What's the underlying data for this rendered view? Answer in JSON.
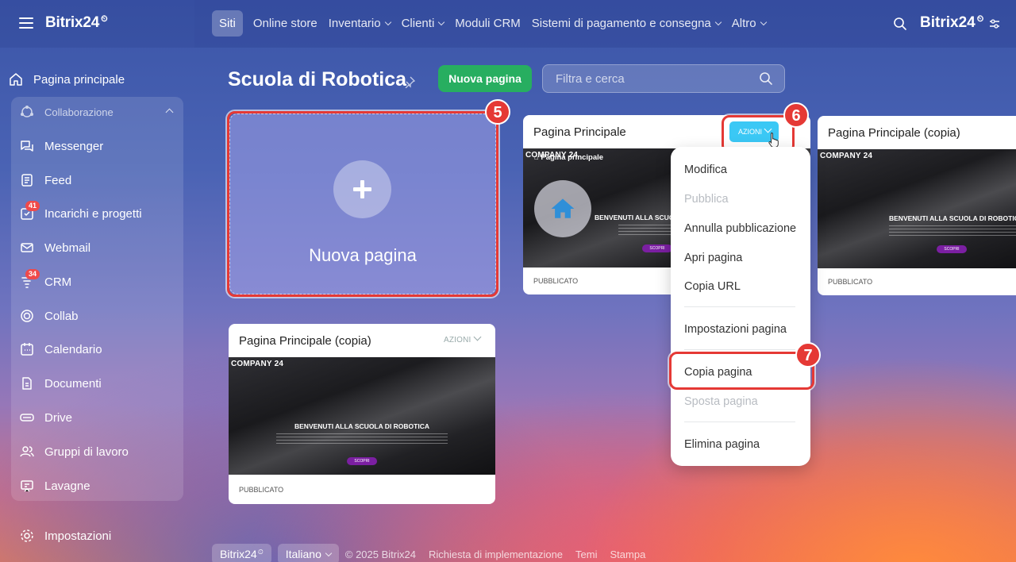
{
  "app": {
    "logo": "Bitrix24",
    "logo_mark": "⏲"
  },
  "topnav": {
    "items": [
      {
        "label": "Siti",
        "active": true,
        "dropdown": false
      },
      {
        "label": "Online store",
        "dropdown": false
      },
      {
        "label": "Inventario",
        "dropdown": true
      },
      {
        "label": "Clienti",
        "dropdown": true
      },
      {
        "label": "Moduli CRM",
        "dropdown": false
      },
      {
        "label": "Sistemi di pagamento e consegna",
        "dropdown": true
      },
      {
        "label": "Altro",
        "dropdown": true
      }
    ],
    "right_logo": "Bitrix24"
  },
  "sidebar": {
    "home": "Pagina principale",
    "group_header": "Collaborazione",
    "items": [
      {
        "label": "Messenger",
        "icon": "messenger-icon"
      },
      {
        "label": "Feed",
        "icon": "feed-icon"
      },
      {
        "label": "Incarichi e progetti",
        "icon": "tasks-icon",
        "badge": "41"
      },
      {
        "label": "Webmail",
        "icon": "mail-icon"
      },
      {
        "label": "CRM",
        "icon": "crm-icon",
        "badge": "34"
      },
      {
        "label": "Collab",
        "icon": "collab-icon"
      },
      {
        "label": "Calendario",
        "icon": "calendar-icon"
      },
      {
        "label": "Documenti",
        "icon": "document-icon"
      },
      {
        "label": "Drive",
        "icon": "drive-icon"
      },
      {
        "label": "Gruppi di lavoro",
        "icon": "groups-icon"
      },
      {
        "label": "Lavagne",
        "icon": "board-icon"
      }
    ],
    "settings": "Impostazioni"
  },
  "page": {
    "title": "Scuola di Robotica",
    "new_button": "Nuova pagina",
    "filter_placeholder": "Filtra e cerca"
  },
  "new_card": {
    "label": "Nuova pagina"
  },
  "cards": [
    {
      "title": "Pagina Principale",
      "actions": "AZIONI",
      "status": "PUBBLICATO",
      "preview_brand": "COMPANY 24",
      "preview_heading": "BENVENUTI ALLA SCUOLA DI ROBOTICA",
      "preview_button": "SCOPRI",
      "preview_page": "Pagina principale"
    },
    {
      "title": "Pagina Principale (copia)",
      "actions": "AZIONI",
      "status": "PUBBLICATO",
      "preview_brand": "COMPANY 24",
      "preview_heading": "BENVENUTI ALLA SCUOLA DI ROBOTICA",
      "preview_button": "SCOPRI"
    },
    {
      "title": "Pagina Principale (copia)",
      "actions": "AZIONI",
      "status": "PUBBLICATO",
      "preview_brand": "COMPANY 24",
      "preview_heading": "BENVENUTI ALLA SCUOLA DI ROBOTICA",
      "preview_button": "SCOPRI"
    }
  ],
  "menu": {
    "items": [
      {
        "label": "Modifica",
        "disabled": false
      },
      {
        "label": "Pubblica",
        "disabled": true
      },
      {
        "label": "Annulla pubblicazione",
        "disabled": false
      },
      {
        "label": "Apri pagina",
        "disabled": false
      },
      {
        "label": "Copia URL",
        "disabled": false
      },
      {
        "label": "Impostazioni pagina",
        "disabled": false
      },
      {
        "label": "Copia pagina",
        "disabled": false
      },
      {
        "label": "Sposta pagina",
        "disabled": true
      },
      {
        "label": "Elimina pagina",
        "disabled": false
      }
    ]
  },
  "callouts": [
    "5",
    "6",
    "7"
  ],
  "footer": {
    "brand": "Bitrix24",
    "language": "Italiano",
    "copyright": "© 2025 Bitrix24",
    "links": [
      "Richiesta di implementazione",
      "Temi",
      "Stampa"
    ]
  },
  "colors": {
    "accent_green": "#27ae60",
    "actions_blue": "#3bc8f5",
    "highlight_red": "#e53935",
    "badge_red": "#f04a4a"
  }
}
